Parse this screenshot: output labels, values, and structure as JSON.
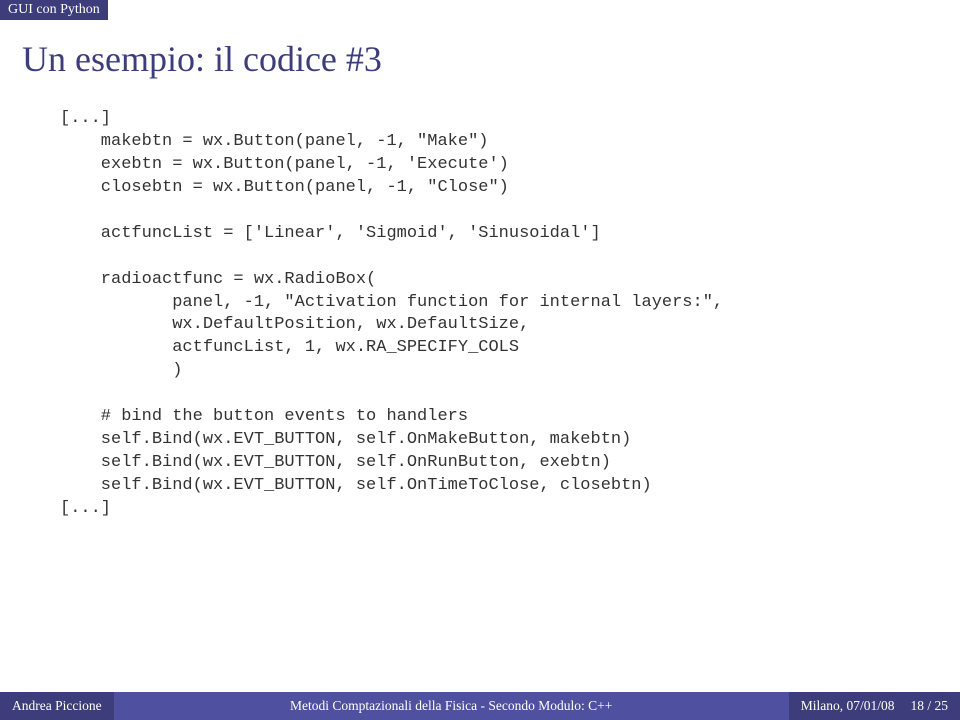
{
  "header": {
    "section": "GUI con Python"
  },
  "title": "Un esempio: il codice #3",
  "code": {
    "ell1": "[...]",
    "l01": "    makebtn = wx.Button(panel, -1, \"Make\")",
    "l02": "    exebtn = wx.Button(panel, -1, 'Execute')",
    "l03": "    closebtn = wx.Button(panel, -1, \"Close\")",
    "l04": "    actfuncList = ['Linear', 'Sigmoid', 'Sinusoidal']",
    "l05": "    radioactfunc = wx.RadioBox(",
    "l06": "           panel, -1, \"Activation function for internal layers:\",",
    "l07": "           wx.DefaultPosition, wx.DefaultSize,",
    "l08": "           actfuncList, 1, wx.RA_SPECIFY_COLS",
    "l09": "           )",
    "l10": "    # bind the button events to handlers",
    "l11": "    self.Bind(wx.EVT_BUTTON, self.OnMakeButton, makebtn)",
    "l12": "    self.Bind(wx.EVT_BUTTON, self.OnRunButton, exebtn)",
    "l13": "    self.Bind(wx.EVT_BUTTON, self.OnTimeToClose, closebtn)",
    "ell2": "[...]"
  },
  "footer": {
    "author": "Andrea Piccione",
    "course": "Metodi Comptazionali della Fisica - Secondo Modulo: C++",
    "place_date": "Milano, 07/01/08",
    "page": "18 / 25"
  }
}
